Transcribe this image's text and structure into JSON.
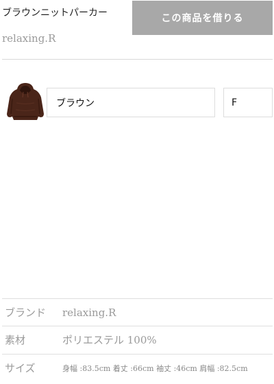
{
  "product": {
    "title": "ブラウンニットパーカー",
    "brand": "relaxing.R"
  },
  "actions": {
    "rent_label": "この商品を借りる"
  },
  "variant": {
    "thumbnail_icon": "hoodie-icon",
    "color": "ブラウン",
    "size": "F"
  },
  "specs": [
    {
      "label": "ブランド",
      "value": "relaxing.R"
    },
    {
      "label": "素材",
      "value": "ポリエステル 100%"
    },
    {
      "label": "サイズ",
      "value": "身幅 :83.5cm 着丈 :66cm 袖丈 :46cm 肩幅 :82.5cm"
    }
  ],
  "colors": {
    "button_bg": "#a8a8a8",
    "muted_text": "#9a9a9a",
    "garment": "#4a2519"
  }
}
